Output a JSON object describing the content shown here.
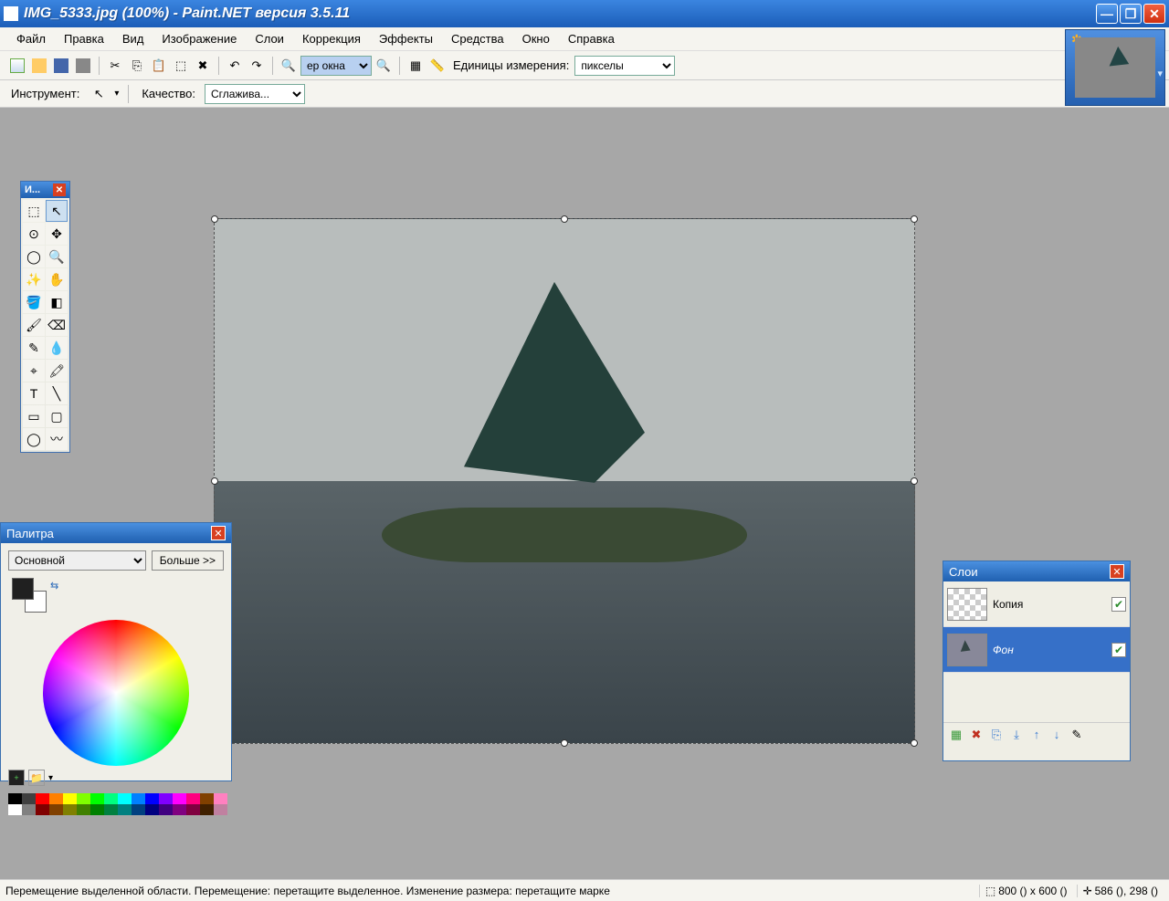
{
  "titlebar": {
    "text": "IMG_5333.jpg (100%) - Paint.NET версия 3.5.11"
  },
  "menu": {
    "items": [
      "Файл",
      "Правка",
      "Вид",
      "Изображение",
      "Слои",
      "Коррекция",
      "Эффекты",
      "Средства",
      "Окно",
      "Справка"
    ]
  },
  "toolbar": {
    "zoom_value": "ер окна",
    "units_label": "Единицы измерения:",
    "units_value": "пикселы"
  },
  "toolbar2": {
    "instrument_label": "Инструмент:",
    "quality_label": "Качество:",
    "quality_value": "Сглажива..."
  },
  "tools_window": {
    "title": "И..."
  },
  "colors_window": {
    "title": "Палитра",
    "mode_value": "Основной",
    "more_label": "Больше >>"
  },
  "layers_window": {
    "title": "Слои",
    "layers": [
      {
        "name": "Копия",
        "visible": true,
        "active": false
      },
      {
        "name": "Фон",
        "visible": true,
        "active": true
      }
    ]
  },
  "statusbar": {
    "text": "Перемещение выделенной области. Перемещение: перетащите выделенное. Изменение размера: перетащите марке",
    "size": "800 () x 600 ()",
    "pos": "586 (), 298 ()"
  },
  "swatch_colors": [
    "#000000",
    "#404040",
    "#ff0000",
    "#ff8000",
    "#ffff00",
    "#80ff00",
    "#00ff00",
    "#00ff80",
    "#00ffff",
    "#0080ff",
    "#0000ff",
    "#8000ff",
    "#ff00ff",
    "#ff0080",
    "#804000",
    "#ff80c0",
    "#ffffff",
    "#808080",
    "#800000",
    "#804000",
    "#808000",
    "#408000",
    "#008000",
    "#008040",
    "#008080",
    "#004080",
    "#000080",
    "#400080",
    "#800080",
    "#800040",
    "#402000",
    "#c080a0"
  ]
}
